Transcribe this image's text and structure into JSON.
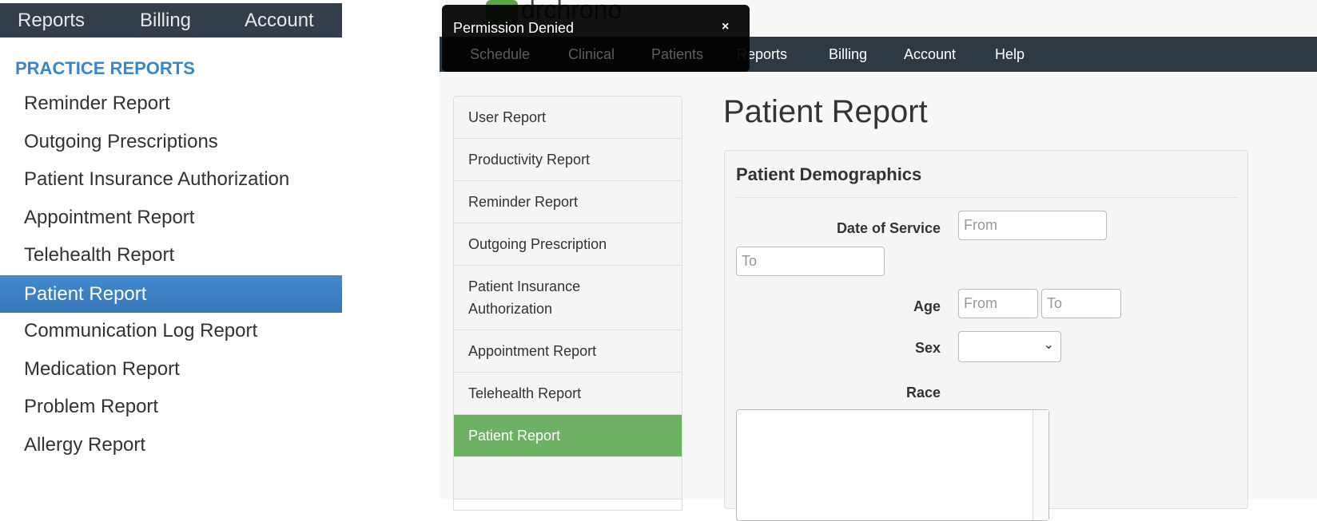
{
  "left": {
    "nav": [
      "Reports",
      "Billing",
      "Account"
    ],
    "heading": "PRACTICE REPORTS",
    "items": [
      "Reminder Report",
      "Outgoing Prescriptions",
      "Patient Insurance Authorization",
      "Appointment Report",
      "Telehealth Report",
      "Patient Report",
      "Communication Log Report",
      "Medication Report",
      "Problem Report",
      "Allergy Report"
    ],
    "active": "Patient Report"
  },
  "right": {
    "logo": "drchrono",
    "nav": [
      "Schedule",
      "Clinical",
      "Patients",
      "Reports",
      "Billing",
      "Account",
      "Help"
    ],
    "toast": {
      "title": "Permission Denied",
      "close": "×"
    },
    "sidebar": [
      "User Report",
      "Productivity Report",
      "Reminder Report",
      "Outgoing Prescription",
      "Patient Insurance Authorization",
      "Appointment Report",
      "Telehealth Report",
      "Patient Report"
    ],
    "page_title": "Patient Report",
    "panel": {
      "heading": "Patient Demographics",
      "date_label": "Date of Service",
      "date_from": "From",
      "date_to": "To",
      "age_label": "Age",
      "age_from": "From",
      "age_to": "To",
      "sex_label": "Sex",
      "sex_value": "",
      "race_label": "Race"
    }
  },
  "colors": {
    "left_active": "#3b7dc0",
    "right_active": "#6db264",
    "nav": "#2e3944"
  }
}
